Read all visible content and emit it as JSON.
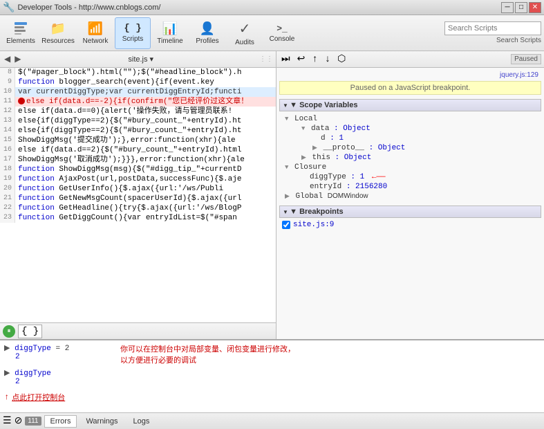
{
  "titlebar": {
    "title": "Developer Tools - http://www.cnblogs.com/",
    "icon": "🔧"
  },
  "toolbar": {
    "buttons": [
      {
        "id": "elements",
        "label": "Elements",
        "icon": "⬜"
      },
      {
        "id": "resources",
        "label": "Resources",
        "icon": "📁"
      },
      {
        "id": "network",
        "label": "Network",
        "icon": "📶"
      },
      {
        "id": "scripts",
        "label": "Scripts",
        "icon": "{}"
      },
      {
        "id": "timeline",
        "label": "Timeline",
        "icon": "📊"
      },
      {
        "id": "profiles",
        "label": "Profiles",
        "icon": "👤"
      },
      {
        "id": "audits",
        "label": "Audits",
        "icon": "✓"
      },
      {
        "id": "console",
        "label": "Console",
        "icon": ">_"
      }
    ],
    "search_placeholder": "Search Scripts"
  },
  "source_file": "site.js",
  "code_lines": [
    {
      "num": "8",
      "text": "$(\"#pager_block\").html(\"\");$(\"#headline_block\").h",
      "type": "normal"
    },
    {
      "num": "9",
      "text": "function blogger_search(event){if(event.key",
      "type": "normal"
    },
    {
      "num": "10",
      "text": "var currentDiggType;var currentDiggEntryId;functi",
      "type": "blue"
    },
    {
      "num": "11",
      "text": "else if(data.d==-2){if(confirm(\"您已经评价过这文章！",
      "type": "highlight",
      "has_breakpoint": true
    },
    {
      "num": "12",
      "text": "else if(data.d==0){alert('操作失败，请与管理员联系!",
      "type": "normal"
    },
    {
      "num": "13",
      "text": "else{if(diggType==2){$(\"#bury_count_\"+entryId).ht",
      "type": "normal"
    },
    {
      "num": "14",
      "text": "else{if(diggType==2){$(\"#bury_count_\"+entryId).ht",
      "type": "normal"
    },
    {
      "num": "15",
      "text": "ShowDiggMsg('提交成功');},error:function(xhr){ale",
      "type": "normal"
    },
    {
      "num": "16",
      "text": "else if(data.d==2){$(\"#bury_count_\"+entryId).html",
      "type": "normal"
    },
    {
      "num": "17",
      "text": "ShowDiggMsg('取消成功');}}},error:function(xhr){ale",
      "type": "normal"
    },
    {
      "num": "18",
      "text": "function ShowDiggMsg(msg){$(\"#digg_tip_\"+currentD",
      "type": "normal"
    },
    {
      "num": "19",
      "text": "function AjaxPost(url,postData,successFunc){$.aje",
      "type": "normal"
    },
    {
      "num": "20",
      "text": "function GetUserInfo(){$.ajax({url:'/ws/Publi",
      "type": "normal"
    },
    {
      "num": "21",
      "text": "function GetNewMsgCount(spacerUserId){$.ajax({url",
      "type": "normal"
    },
    {
      "num": "22",
      "text": "function GetHeadline(){try{$.ajax({url:'/ws/BlogP",
      "type": "normal"
    },
    {
      "num": "23",
      "text": "function GetDiggCount(){var entryIdList=$(\"#span",
      "type": "normal"
    }
  ],
  "right_panel": {
    "nav_buttons": [
      "◀",
      "▶",
      "↑",
      "↓",
      "⬡"
    ],
    "status": "Paused",
    "call_stack_ref": "jquery.js:129",
    "pause_message": "Paused on a JavaScript breakpoint.",
    "scope_variables": {
      "title": "▼ Scope Variables",
      "local": {
        "label": "Local",
        "items": [
          {
            "key": "data",
            "val": ": Object",
            "expandable": true,
            "children": [
              {
                "key": "d",
                "val": ": 1"
              },
              {
                "key": "▶ __proto__",
                "val": ": Object",
                "expandable": true
              }
            ]
          },
          {
            "key": "▶ this",
            "val": ": Object",
            "expandable": true
          }
        ]
      },
      "closure": {
        "label": "Closure",
        "items": [
          {
            "key": "diggType",
            "val": ": 1",
            "has_arrow": true
          },
          {
            "key": "entryId",
            "val": ": 2156280"
          }
        ]
      },
      "global": {
        "label": "Global",
        "val": "DOMWindow"
      }
    },
    "breakpoints": {
      "title": "▼ Breakpoints",
      "items": [
        {
          "checked": true,
          "file": "site.js:9"
        }
      ]
    }
  },
  "console": {
    "lines": [
      {
        "type": "expand",
        "label": "▶ diggType = 2",
        "value": "2",
        "comment": "你可以在控制台中对局部变量、闭包变量进行修改，"
      },
      {
        "type": "blank"
      },
      {
        "type": "expand",
        "label": "▶ diggType",
        "value": "2",
        "comment": "以方便进行必要的调试"
      },
      {
        "type": "blank"
      },
      {
        "type": "blank"
      }
    ],
    "note_label": "点此打开控制台"
  },
  "bottom_status": {
    "badge": "111",
    "tabs": [
      "Errors",
      "Warnings",
      "Logs"
    ]
  }
}
